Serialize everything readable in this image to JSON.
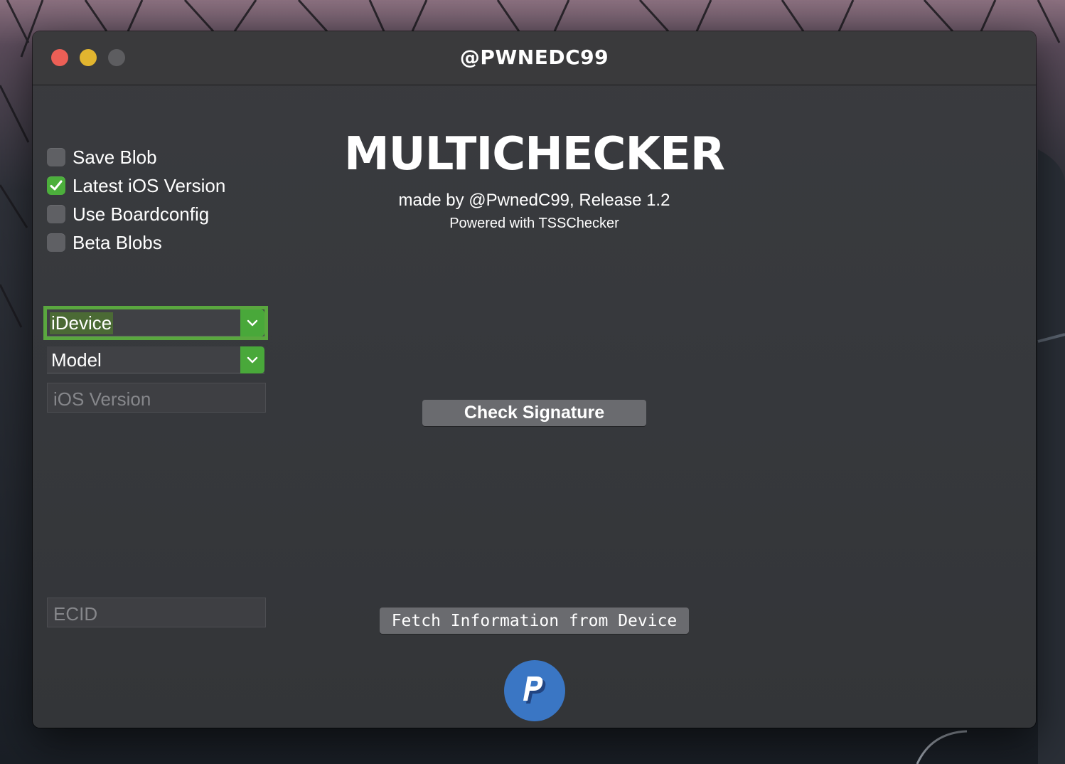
{
  "window": {
    "title": "@PWNEDC99",
    "traffic_lights": [
      "close",
      "minimize",
      "maximize"
    ]
  },
  "options": [
    {
      "label": "Save Blob",
      "checked": false
    },
    {
      "label": "Latest iOS Version",
      "checked": true
    },
    {
      "label": "Use Boardconfig",
      "checked": false
    },
    {
      "label": "Beta Blobs",
      "checked": false
    }
  ],
  "selectors": {
    "device": {
      "value": "iDevice",
      "focused": true
    },
    "model": {
      "value": "Model"
    }
  },
  "fields": {
    "ios_version": {
      "placeholder": "iOS Version"
    },
    "ecid": {
      "placeholder": "ECID"
    }
  },
  "header": {
    "app_name": "MULTICHECKER",
    "subtitle": "made by @PwnedC99, Release 1.2",
    "powered": "Powered with TSSChecker"
  },
  "actions": {
    "check_signature": "Check Signature",
    "fetch_info": "Fetch Information from Device"
  },
  "donate": {
    "icon": "paypal-icon"
  },
  "colors": {
    "accent_green": "#4caf3c",
    "close": "#ec5f56",
    "minimize": "#e2b52f",
    "paypal_blue": "#3a76c4"
  }
}
